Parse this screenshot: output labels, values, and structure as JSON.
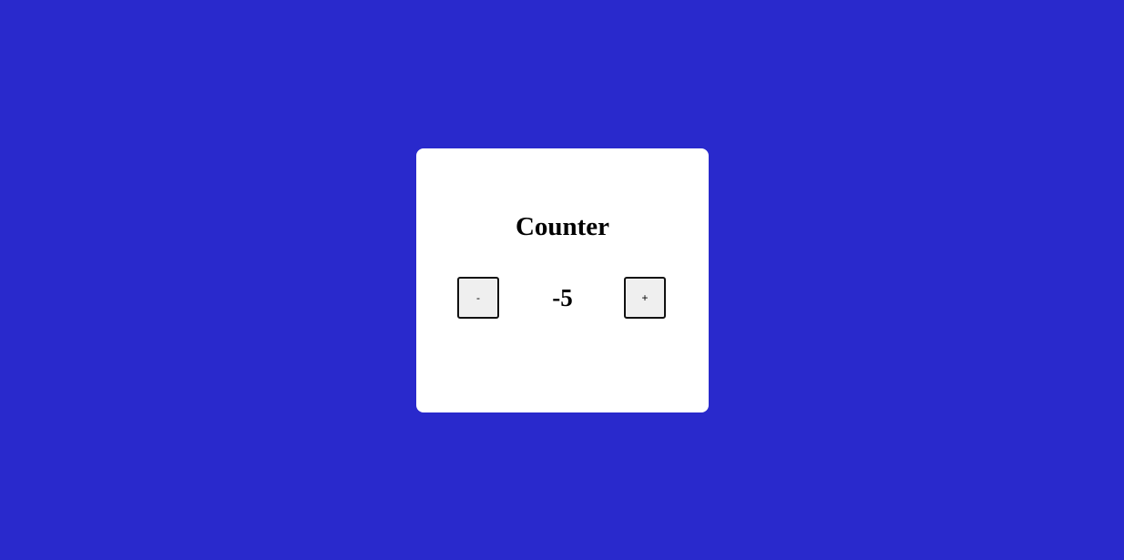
{
  "colors": {
    "background": "#2929cc",
    "card": "#ffffff",
    "button_bg": "#efefef",
    "button_border": "#111111"
  },
  "counter": {
    "title": "Counter",
    "decrement_label": "-",
    "value": "-5",
    "increment_label": "+"
  }
}
